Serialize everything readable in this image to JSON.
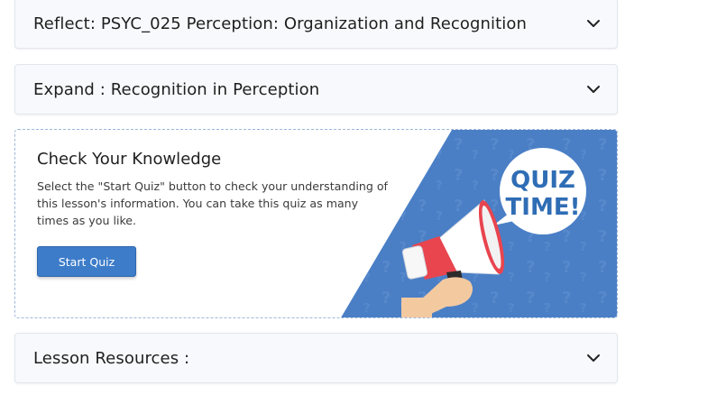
{
  "accordions": [
    {
      "title": "Reflect: PSYC_025 Perception: Organization and Recognition",
      "icon": "chevron-down-icon"
    },
    {
      "title": "Expand : Recognition in Perception",
      "icon": "chevron-down-icon"
    },
    {
      "title": "Lesson Resources :",
      "icon": "chevron-down-icon"
    }
  ],
  "quiz_card": {
    "title": "Check Your Knowledge",
    "description": "Select the \"Start Quiz\" button to check your understanding of this lesson's information. You can take this quiz as many times as you like.",
    "button_label": "Start Quiz",
    "badge_line1": "QUIZ",
    "badge_line2": "TIME!",
    "illustration_icon": "megaphone-icon"
  },
  "colors": {
    "accent_blue": "#3d7cc9",
    "panel_blue": "#4a7fc6",
    "badge_text": "#2f6db5",
    "megaphone_red": "#e8454f"
  }
}
